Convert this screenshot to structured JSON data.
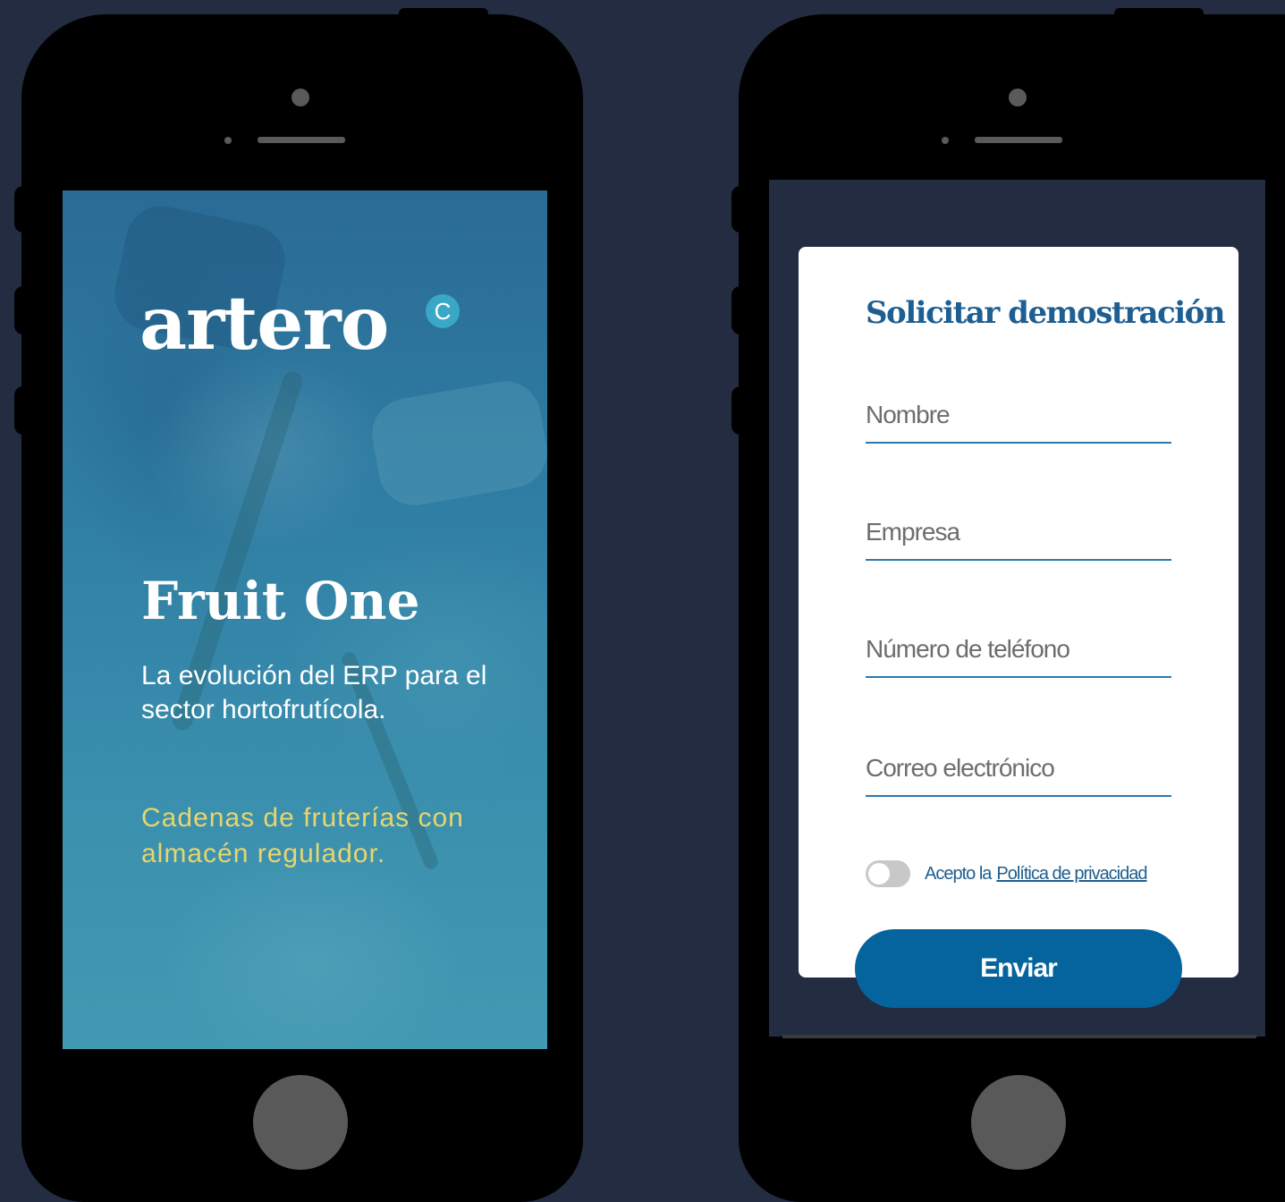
{
  "left_phone": {
    "logo_text": "artero",
    "logo_badge": "C",
    "title": "Fruit One",
    "subtitle": "La evolución del ERP para el sector hortofrutícola.",
    "highlight": "Cadenas de fruterías con almacén regulador."
  },
  "right_phone": {
    "form_title": "Solicitar demostración",
    "fields": [
      {
        "placeholder": "Nombre",
        "value": ""
      },
      {
        "placeholder": "Empresa",
        "value": ""
      },
      {
        "placeholder": "Número de teléfono",
        "value": ""
      },
      {
        "placeholder": "Correo electrónico",
        "value": ""
      }
    ],
    "consent_text": "Acepto la",
    "consent_link": "Política de privacidad",
    "consent_toggle_on": false,
    "submit_label": "Enviar"
  },
  "colors": {
    "page_background": "#232c40",
    "phone_body": "#000000",
    "form_accent": "#1d5f93",
    "button": "#05649e",
    "highlight_text": "#e8d56b"
  }
}
